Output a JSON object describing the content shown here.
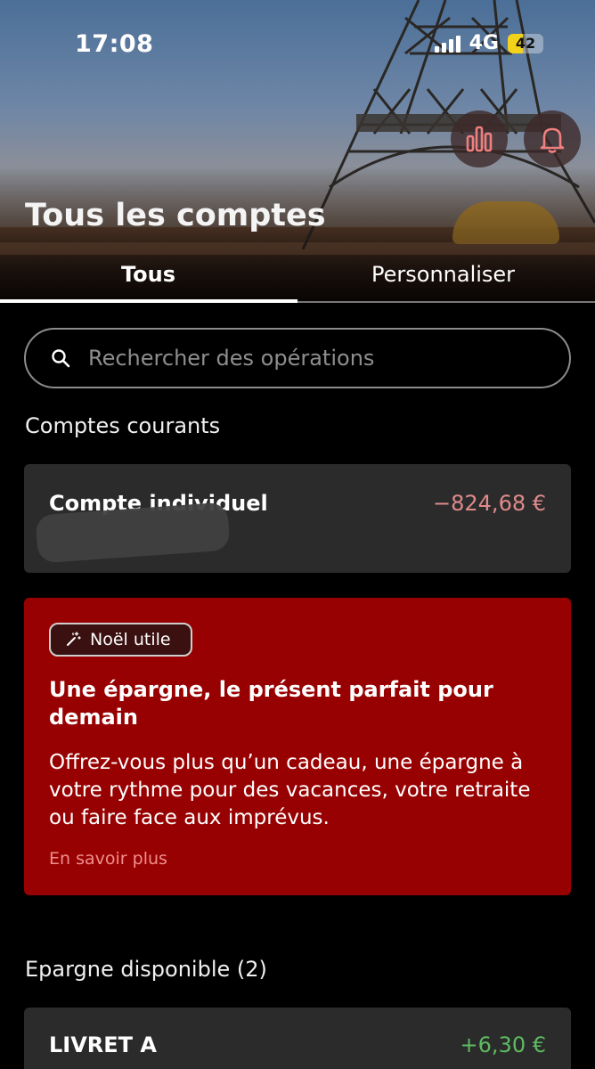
{
  "status_bar": {
    "time": "17:08",
    "network": "4G",
    "battery": "42",
    "battery_level": 0.42,
    "battery_color": "#f2d21b"
  },
  "header": {
    "title": "Tous les comptes",
    "tabs": [
      {
        "label": "Tous",
        "active": true
      },
      {
        "label": "Personnaliser",
        "active": false
      }
    ],
    "icons": [
      "bar-chart-icon",
      "bell-icon"
    ]
  },
  "search": {
    "placeholder": "Rechercher des opérations"
  },
  "sections": {
    "current_title": "Comptes courants",
    "savings_title": "Epargne disponible (2)"
  },
  "accounts": {
    "current": [
      {
        "name": "Compte individuel",
        "amount": "−824,68 €",
        "amount_color": "#e08a8a"
      }
    ],
    "savings": [
      {
        "name": "LIVRET A",
        "amount": "+6,30 €",
        "amount_color": "#5dbb61"
      }
    ]
  },
  "promo": {
    "chip": "Noël utile",
    "title": "Une épargne, le présent parfait pour demain",
    "body": "Offrez-vous plus qu’un cadeau, une épargne à votre rythme pour des vacances, votre retraite ou faire face aux imprévus.",
    "link": "En savoir plus",
    "background": "#980101"
  },
  "colors": {
    "accent_icon": "#f08080",
    "card_bg": "#2b2b2b"
  }
}
